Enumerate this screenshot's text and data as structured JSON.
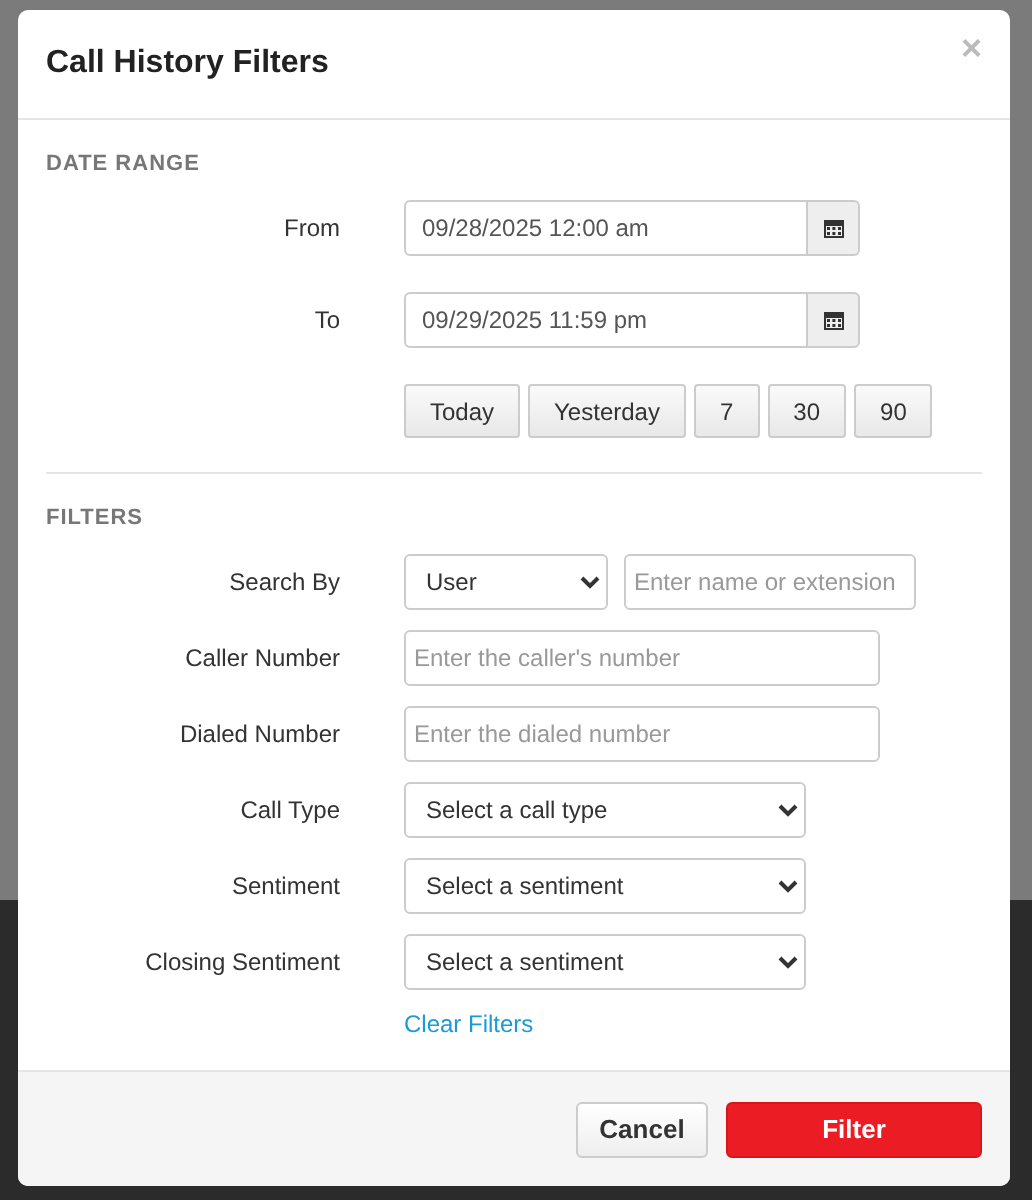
{
  "dialog": {
    "title": "Call History Filters",
    "close": "×"
  },
  "date_range": {
    "heading": "DATE RANGE",
    "fields": [
      {
        "label": "From",
        "value": "09/28/2025 12:00 am"
      },
      {
        "label": "To",
        "value": "09/29/2025 11:59 pm"
      }
    ],
    "presets": [
      "Today",
      "Yesterday",
      "7",
      "30",
      "90"
    ]
  },
  "filters": {
    "heading": "FILTERS",
    "rows": [
      {
        "label": "Search By",
        "controls": [
          {
            "kind": "select",
            "value": "User"
          },
          {
            "kind": "text",
            "placeholder": "Enter name or extension"
          }
        ]
      },
      {
        "label": "Caller Number",
        "controls": [
          {
            "kind": "text",
            "placeholder": "Enter the caller's number"
          }
        ]
      },
      {
        "label": "Dialed Number",
        "controls": [
          {
            "kind": "text",
            "placeholder": "Enter the dialed number"
          }
        ]
      },
      {
        "label": "Call Type",
        "controls": [
          {
            "kind": "select",
            "value": "Select a call type"
          }
        ]
      },
      {
        "label": "Sentiment",
        "controls": [
          {
            "kind": "select",
            "value": "Select a sentiment"
          }
        ]
      },
      {
        "label": "Closing Sentiment",
        "controls": [
          {
            "kind": "select",
            "value": "Select a sentiment"
          }
        ]
      }
    ],
    "clear_link": "Clear Filters"
  },
  "buttons": [
    {
      "label": "Cancel",
      "kind": "secondary"
    },
    {
      "label": "Filter",
      "kind": "primary"
    }
  ]
}
